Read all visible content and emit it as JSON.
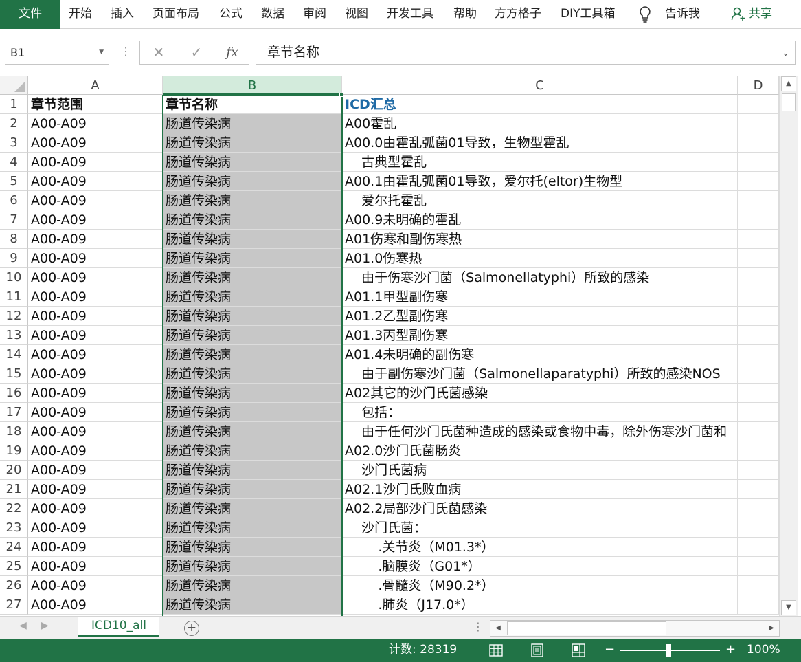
{
  "ribbon": {
    "file": "文件",
    "tabs": [
      "开始",
      "插入",
      "页面布局",
      "公式",
      "数据",
      "审阅",
      "视图",
      "开发工具",
      "帮助",
      "方方格子",
      "DIY工具箱"
    ],
    "tell_me": "告诉我",
    "share": "共享"
  },
  "formula_bar": {
    "name_box": "B1",
    "fx": "fx",
    "content": "章节名称"
  },
  "columns": [
    "A",
    "B",
    "C",
    "D"
  ],
  "rows": [
    {
      "n": "1",
      "a": "章节范围",
      "b": "章节名称",
      "c": "ICD汇总"
    },
    {
      "n": "2",
      "a": "A00-A09",
      "b": "肠道传染病",
      "c": "A00霍乱"
    },
    {
      "n": "3",
      "a": "A00-A09",
      "b": "肠道传染病",
      "c": "A00.0由霍乱弧菌01导致，生物型霍乱"
    },
    {
      "n": "4",
      "a": "A00-A09",
      "b": "肠道传染病",
      "c": "    古典型霍乱"
    },
    {
      "n": "5",
      "a": "A00-A09",
      "b": "肠道传染病",
      "c": "A00.1由霍乱弧菌01导致，爱尔托(eltor)生物型"
    },
    {
      "n": "6",
      "a": "A00-A09",
      "b": "肠道传染病",
      "c": "    爱尔托霍乱"
    },
    {
      "n": "7",
      "a": "A00-A09",
      "b": "肠道传染病",
      "c": "A00.9未明确的霍乱"
    },
    {
      "n": "8",
      "a": "A00-A09",
      "b": "肠道传染病",
      "c": "A01伤寒和副伤寒热"
    },
    {
      "n": "9",
      "a": "A00-A09",
      "b": "肠道传染病",
      "c": "A01.0伤寒热"
    },
    {
      "n": "10",
      "a": "A00-A09",
      "b": "肠道传染病",
      "c": "    由于伤寒沙门菌（Salmonellatyphi）所致的感染"
    },
    {
      "n": "11",
      "a": "A00-A09",
      "b": "肠道传染病",
      "c": "A01.1甲型副伤寒"
    },
    {
      "n": "12",
      "a": "A00-A09",
      "b": "肠道传染病",
      "c": "A01.2乙型副伤寒"
    },
    {
      "n": "13",
      "a": "A00-A09",
      "b": "肠道传染病",
      "c": "A01.3丙型副伤寒"
    },
    {
      "n": "14",
      "a": "A00-A09",
      "b": "肠道传染病",
      "c": "A01.4未明确的副伤寒"
    },
    {
      "n": "15",
      "a": "A00-A09",
      "b": "肠道传染病",
      "c": "    由于副伤寒沙门菌（Salmonellaparatyphi）所致的感染NOS"
    },
    {
      "n": "16",
      "a": "A00-A09",
      "b": "肠道传染病",
      "c": "A02其它的沙门氏菌感染"
    },
    {
      "n": "17",
      "a": "A00-A09",
      "b": "肠道传染病",
      "c": "    包括："
    },
    {
      "n": "18",
      "a": "A00-A09",
      "b": "肠道传染病",
      "c": "    由于任何沙门氏菌种造成的感染或食物中毒，除外伤寒沙门菌和"
    },
    {
      "n": "19",
      "a": "A00-A09",
      "b": "肠道传染病",
      "c": "A02.0沙门氏菌肠炎"
    },
    {
      "n": "20",
      "a": "A00-A09",
      "b": "肠道传染病",
      "c": "    沙门氏菌病"
    },
    {
      "n": "21",
      "a": "A00-A09",
      "b": "肠道传染病",
      "c": "A02.1沙门氏败血病"
    },
    {
      "n": "22",
      "a": "A00-A09",
      "b": "肠道传染病",
      "c": "A02.2局部沙门氏菌感染"
    },
    {
      "n": "23",
      "a": "A00-A09",
      "b": "肠道传染病",
      "c": "    沙门氏菌："
    },
    {
      "n": "24",
      "a": "A00-A09",
      "b": "肠道传染病",
      "c": "        .关节炎（M01.3*）"
    },
    {
      "n": "25",
      "a": "A00-A09",
      "b": "肠道传染病",
      "c": "        .脑膜炎（G01*）"
    },
    {
      "n": "26",
      "a": "A00-A09",
      "b": "肠道传染病",
      "c": "        .骨髓炎（M90.2*）"
    },
    {
      "n": "27",
      "a": "A00-A09",
      "b": "肠道传染病",
      "c": "        .肺炎（J17.0*）"
    }
  ],
  "sheet_tabs": [
    "ICD10_all"
  ],
  "status": {
    "count": "计数: 28319",
    "zoom": "100%",
    "zoom_level": 1.0
  },
  "colors": {
    "accent": "#217346",
    "header_text": "#1f6aa5",
    "selection_fill": "#c7c7c7"
  }
}
